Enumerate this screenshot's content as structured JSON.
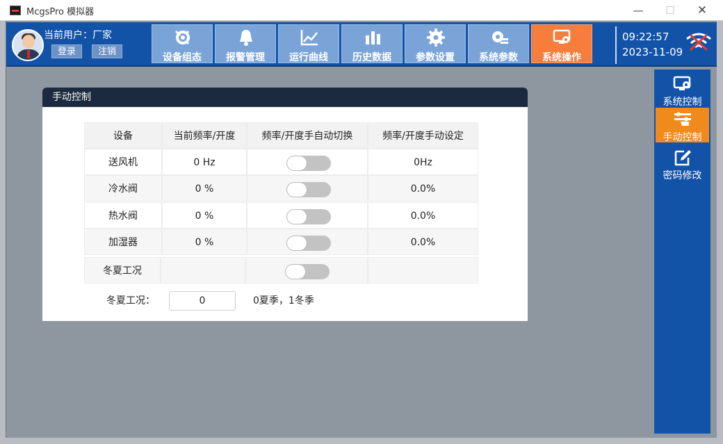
{
  "window": {
    "title": "McgsPro 模拟器"
  },
  "user": {
    "label": "当前用户：厂家",
    "login": "登录",
    "logout": "注销"
  },
  "nav": {
    "items": [
      {
        "label": "设备组态",
        "icon": "wrench-gear-icon"
      },
      {
        "label": "报警管理",
        "icon": "bell-icon"
      },
      {
        "label": "运行曲线",
        "icon": "line-chart-icon"
      },
      {
        "label": "历史数据",
        "icon": "bar-chart-icon"
      },
      {
        "label": "参数设置",
        "icon": "gear-icon"
      },
      {
        "label": "系统参数",
        "icon": "gear-list-icon"
      },
      {
        "label": "系统操作",
        "icon": "monitor-gear-icon",
        "active": true
      }
    ]
  },
  "clock": {
    "time": "09:22:57",
    "date": "2023-11-09"
  },
  "panel": {
    "title": "手动控制",
    "headers": [
      "设备",
      "当前频率/开度",
      "频率/开度手自动切换",
      "频率/开度手动设定"
    ],
    "rows": [
      {
        "device": "送风机",
        "current": "0  Hz",
        "toggle": false,
        "setting": "0Hz"
      },
      {
        "device": "冷水阀",
        "current": "0  %",
        "toggle": false,
        "setting": "0.0%"
      },
      {
        "device": "热水阀",
        "current": "0  %",
        "toggle": false,
        "setting": "0.0%"
      },
      {
        "device": "加湿器",
        "current": "0  %",
        "toggle": false,
        "setting": "0.0%"
      },
      {
        "device": "冬夏工况",
        "current": "",
        "toggle": false,
        "setting": ""
      }
    ],
    "season_label": "冬夏工况：",
    "season_value": "0",
    "season_hint": "0夏季，1冬季"
  },
  "sidebar": {
    "items": [
      {
        "label": "系统控制",
        "icon": "monitor-gear-icon"
      },
      {
        "label": "手动控制",
        "icon": "hand-control-icon",
        "active": true
      },
      {
        "label": "密码修改",
        "icon": "edit-icon"
      }
    ]
  },
  "colors": {
    "primary": "#1253a8",
    "accent": "#f77d3c",
    "nav_button": "#7aa4d8",
    "panel_header": "#1b2a3f"
  }
}
